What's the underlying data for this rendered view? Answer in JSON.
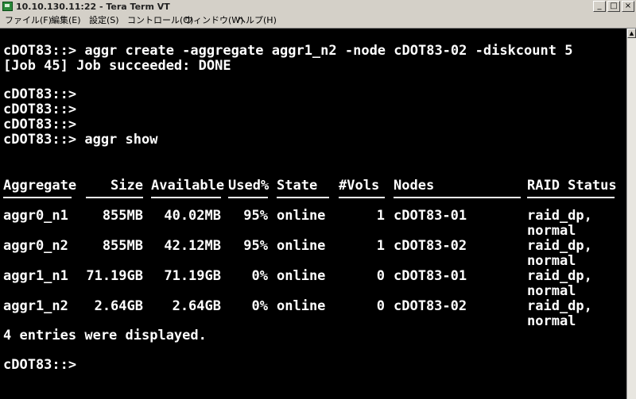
{
  "window": {
    "title": "10.10.130.11:22 - Tera Term VT",
    "minimize_glyph": "_",
    "maximize_glyph": "□",
    "close_glyph": "×"
  },
  "menu": [
    "ファイル(F)",
    "編集(E)",
    "設定(S)",
    "コントロール(O)",
    "ウィンドウ(W)",
    "ヘルプ(H)"
  ],
  "terminal": {
    "lines": [
      "cDOT83::> aggr create -aggregate aggr1_n2 -node cDOT83-02 -diskcount 5",
      "[Job 45] Job succeeded: DONE",
      "",
      "cDOT83::>",
      "cDOT83::>",
      "cDOT83::>",
      "cDOT83::> aggr show"
    ],
    "table": {
      "headers": [
        "Aggregate",
        "Size",
        "Available",
        "Used%",
        "State",
        "#Vols",
        "Nodes",
        "RAID Status"
      ],
      "rows": [
        {
          "aggregate": "aggr0_n1",
          "size": "855MB",
          "available": "40.02MB",
          "used": "95%",
          "state": "online",
          "vols": "1",
          "node": "cDOT83-01",
          "raid": "raid_dp,",
          "raid2": "normal"
        },
        {
          "aggregate": "aggr0_n2",
          "size": "855MB",
          "available": "42.12MB",
          "used": "95%",
          "state": "online",
          "vols": "1",
          "node": "cDOT83-02",
          "raid": "raid_dp,",
          "raid2": "normal"
        },
        {
          "aggregate": "aggr1_n1",
          "size": "71.19GB",
          "available": "71.19GB",
          "used": "0%",
          "state": "online",
          "vols": "0",
          "node": "cDOT83-01",
          "raid": "raid_dp,",
          "raid2": "normal"
        },
        {
          "aggregate": "aggr1_n2",
          "size": "2.64GB",
          "available": "2.64GB",
          "used": "0%",
          "state": "online",
          "vols": "0",
          "node": "cDOT83-02",
          "raid": "raid_dp,",
          "raid2": "normal"
        }
      ]
    },
    "summary": "4 entries were displayed.",
    "prompt": "cDOT83::>"
  }
}
